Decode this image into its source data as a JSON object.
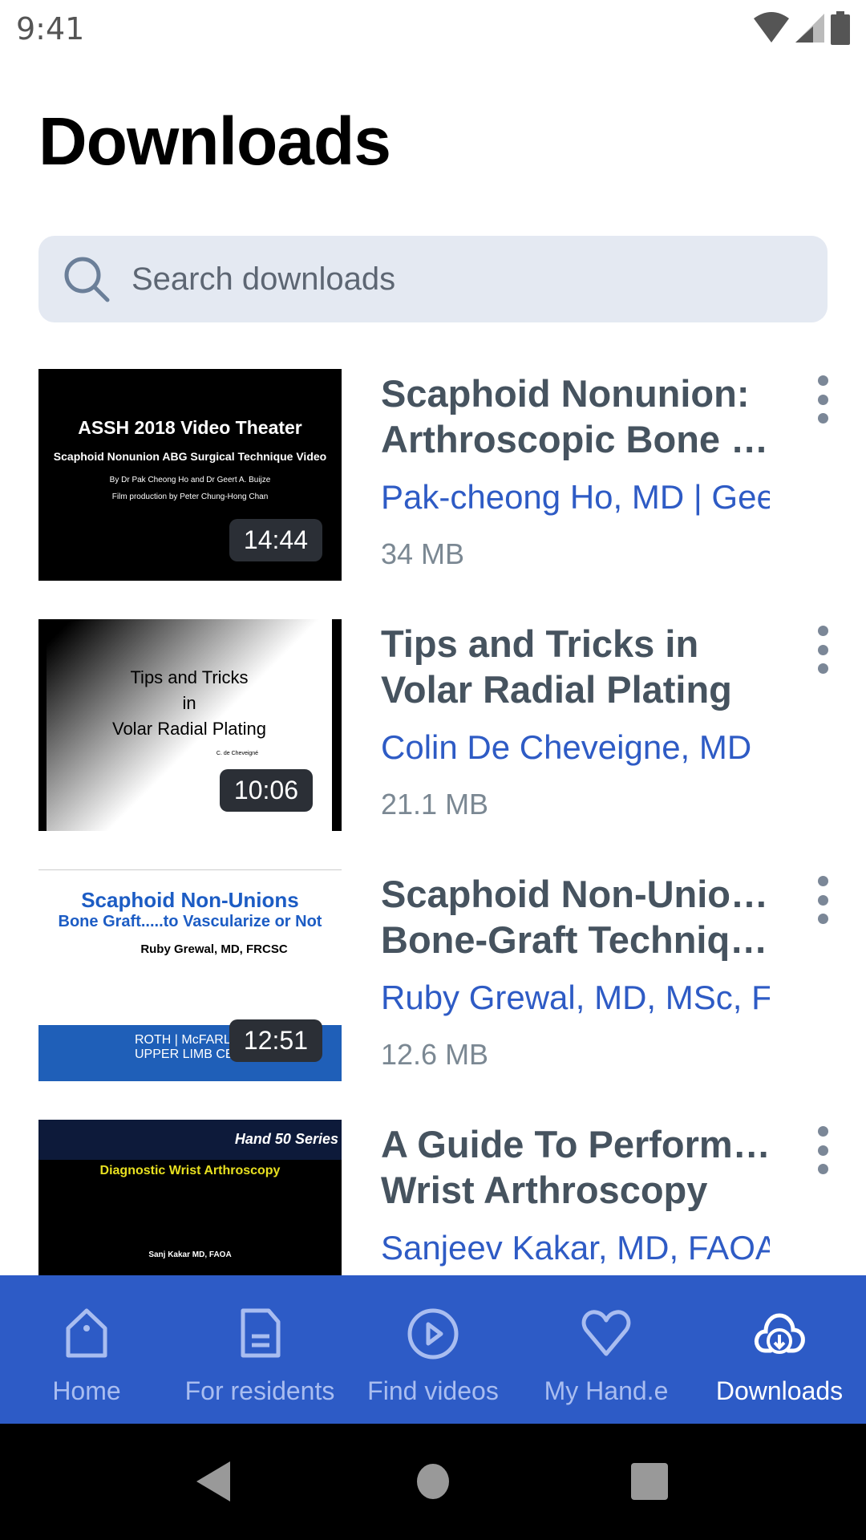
{
  "status_bar": {
    "time": "9:41"
  },
  "page_title": "Downloads",
  "search": {
    "placeholder": "Search downloads"
  },
  "items": [
    {
      "title_line1": "Scaphoid Nonunion:",
      "title_line2": "Arthroscopic Bone G...",
      "author": "Pak-cheong  Ho, MD | Geert A. Buijze",
      "size": "34 MB",
      "duration": "14:44",
      "thumb": {
        "line1": "ASSH 2018 Video Theater",
        "line2": "Scaphoid Nonunion ABG Surgical Technique Video",
        "line3": "By Dr Pak Cheong Ho and Dr Geert A. Buijze",
        "line4": "Film production by Peter Chung-Hong Chan"
      }
    },
    {
      "title_line1": "Tips and Tricks in",
      "title_line2": "Volar Radial Plating",
      "author": "Colin  De Cheveigne, MD",
      "size": "21.1 MB",
      "duration": "10:06",
      "thumb": {
        "line1": "Tips and Tricks",
        "line2": "in",
        "line3": "Volar Radial Plating",
        "line4": "C. de Cheveigné"
      }
    },
    {
      "title_line1": "Scaphoid Non-Unions:",
      "title_line2": "Bone-Graft Techniqu...",
      "author": "Ruby  Grewal, MD, MSc, FRCSC",
      "size": "12.6 MB",
      "duration": "12:51",
      "thumb": {
        "line1": "Scaphoid Non-Unions",
        "line2": "Bone Graft.....to Vascularize or Not",
        "line3": "Ruby Grewal, MD, FRCSC",
        "line4": "ROTH | McFARLANE HAND & UPPER LIMB CENTRE"
      }
    },
    {
      "title_line1": "A Guide To Performing",
      "title_line2": "Wrist Arthroscopy",
      "author": "Sanjeev  Kakar, MD, FAOA",
      "size": "",
      "duration": "",
      "thumb": {
        "line1": "Hand 50 Series",
        "line2": "Diagnostic Wrist Arthroscopy",
        "line3": "Sanj Kakar MD, FAOA",
        "line4": ""
      }
    }
  ],
  "tabs": [
    {
      "label": "Home",
      "icon": "home-icon"
    },
    {
      "label": "For residents",
      "icon": "document-icon"
    },
    {
      "label": "Find videos",
      "icon": "play-circle-icon"
    },
    {
      "label": "My Hand.e",
      "icon": "heart-icon"
    },
    {
      "label": "Downloads",
      "icon": "cloud-download-icon",
      "active": true
    }
  ],
  "colors": {
    "accent": "#2d5bc6",
    "author": "#2e5bc5",
    "title": "#46535f"
  }
}
